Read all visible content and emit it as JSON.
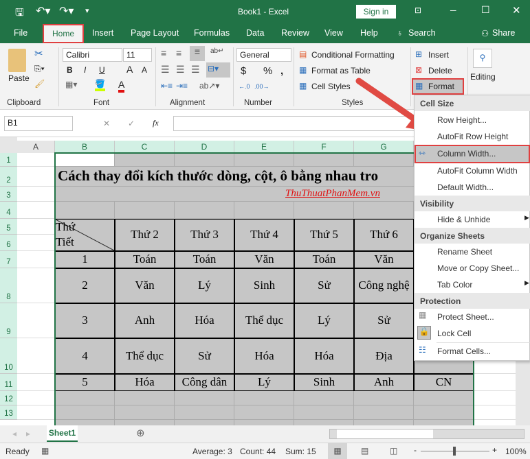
{
  "titlebar": {
    "title": "Book1  -  Excel",
    "sign_in": "Sign in"
  },
  "tabs": [
    "File",
    "Home",
    "Insert",
    "Page Layout",
    "Formulas",
    "Data",
    "Review",
    "View",
    "Help"
  ],
  "search_label": "Search",
  "share_label": "Share",
  "ribbon": {
    "clipboard": {
      "paste": "Paste",
      "label": "Clipboard"
    },
    "font": {
      "name": "Calibri",
      "size": "11",
      "bold": "B",
      "italic": "I",
      "underline": "U",
      "label": "Font",
      "fill_color": "#ccff00",
      "font_color": "#e01010"
    },
    "alignment": {
      "label": "Alignment"
    },
    "number": {
      "format": "General",
      "currency": "$",
      "percent": "%",
      "comma": ",",
      "label": "Number"
    },
    "styles": {
      "conditional": "Conditional Formatting",
      "format_table": "Format as Table",
      "cell_styles": "Cell Styles",
      "label": "Styles"
    },
    "cells": {
      "insert": "Insert",
      "delete": "Delete",
      "format": "Format"
    },
    "editing": {
      "label": "Editing"
    }
  },
  "formula_bar": {
    "name_box": "B1",
    "fx": "fx",
    "value": ""
  },
  "columns": [
    "A",
    "B",
    "C",
    "D",
    "E",
    "F",
    "G"
  ],
  "rows": [
    "1",
    "2",
    "3",
    "4",
    "5",
    "6",
    "7",
    "8",
    "9",
    "10",
    "11",
    "12",
    "13"
  ],
  "sheet": {
    "title": "Cách thay đổi kích thước dòng, cột, ô bằng nhau tro",
    "link": "ThuThuatPhanMem.vn",
    "corner_top": "Thứ",
    "corner_bottom": "Tiết",
    "headers": [
      "Thứ 2",
      "Thứ 3",
      "Thứ 4",
      "Thứ 5",
      "Thứ 6"
    ],
    "periods": [
      "1",
      "2",
      "3",
      "4",
      "5"
    ],
    "schedule": [
      [
        "Toán",
        "Toán",
        "Văn",
        "Toán",
        "Văn",
        ""
      ],
      [
        "Văn",
        "Lý",
        "Sinh",
        "Sử",
        "Công nghệ",
        ""
      ],
      [
        "Anh",
        "Hóa",
        "Thể dục",
        "Lý",
        "Sử",
        ""
      ],
      [
        "Thể dục",
        "Sử",
        "Hóa",
        "Hóa",
        "Địa",
        ""
      ],
      [
        "Hóa",
        "Công dân",
        "Lý",
        "Sinh",
        "Anh",
        "CN"
      ]
    ]
  },
  "menu": {
    "sections": [
      "Cell Size",
      "Visibility",
      "Organize Sheets",
      "Protection"
    ],
    "items": [
      "Row Height...",
      "AutoFit Row Height",
      "Column Width...",
      "AutoFit Column Width",
      "Default Width...",
      "Hide & Unhide",
      "Rename Sheet",
      "Move or Copy Sheet...",
      "Tab Color",
      "Protect Sheet...",
      "Lock Cell",
      "Format Cells..."
    ]
  },
  "sheet_tab": "Sheet1",
  "status": {
    "ready": "Ready",
    "average": "Average: 3",
    "count": "Count: 44",
    "sum": "Sum: 15",
    "zoom": "100%",
    "zoom_level": 100
  },
  "colors": {
    "brand": "#217346",
    "highlight": "#e04040",
    "cell_fill": "#c6c6c6"
  }
}
